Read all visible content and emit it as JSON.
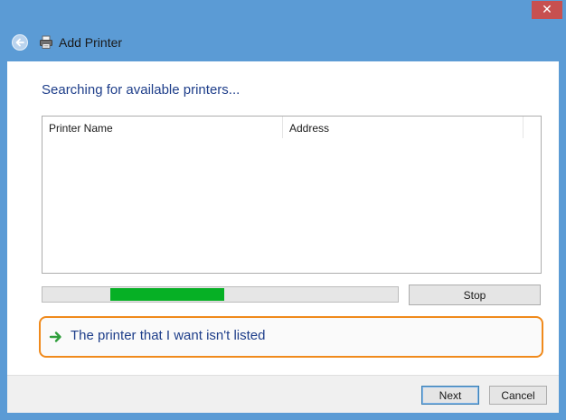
{
  "window": {
    "title": "Add Printer",
    "close_glyph": "✕"
  },
  "icons": {
    "back": "back-arrow-icon",
    "printer": "printer-icon",
    "link_arrow": "green-arrow-icon"
  },
  "main": {
    "heading": "Searching for available printers...",
    "columns": [
      {
        "label": "Printer Name"
      },
      {
        "label": "Address"
      }
    ],
    "progress": {
      "start_fraction": 0.19,
      "end_fraction": 0.51,
      "color": "#06b025"
    },
    "stop_label": "Stop",
    "not_listed_link": "The printer that I want isn't listed"
  },
  "footer": {
    "next_label": "Next",
    "cancel_label": "Cancel"
  },
  "colors": {
    "frame": "#5b9bd5",
    "heading": "#1e3e8a",
    "highlight": "#f08a1c",
    "close": "#c75050"
  }
}
